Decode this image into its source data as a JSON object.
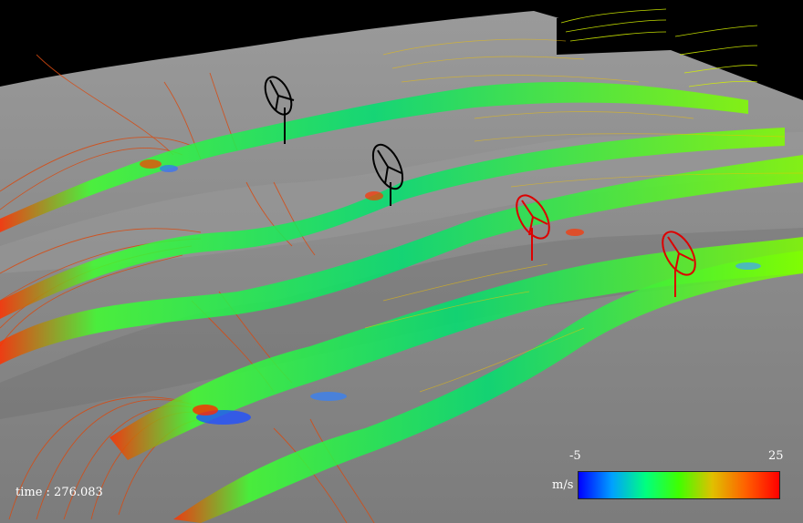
{
  "overlay": {
    "time_text": "time : 276.083"
  },
  "colorbar": {
    "min_label": "-5",
    "max_label": "25",
    "unit": "m/s",
    "min": -5,
    "max": 25,
    "colors": [
      "#0000ff",
      "#00a0ff",
      "#00ff80",
      "#40ff00",
      "#e0c000",
      "#ff6000",
      "#ff0000"
    ]
  },
  "scene": {
    "background_color": "#000000",
    "terrain_color": "#8a8a8a",
    "turbine_colors": [
      "#000000",
      "#000000",
      "#dd0000",
      "#dd0000"
    ]
  }
}
